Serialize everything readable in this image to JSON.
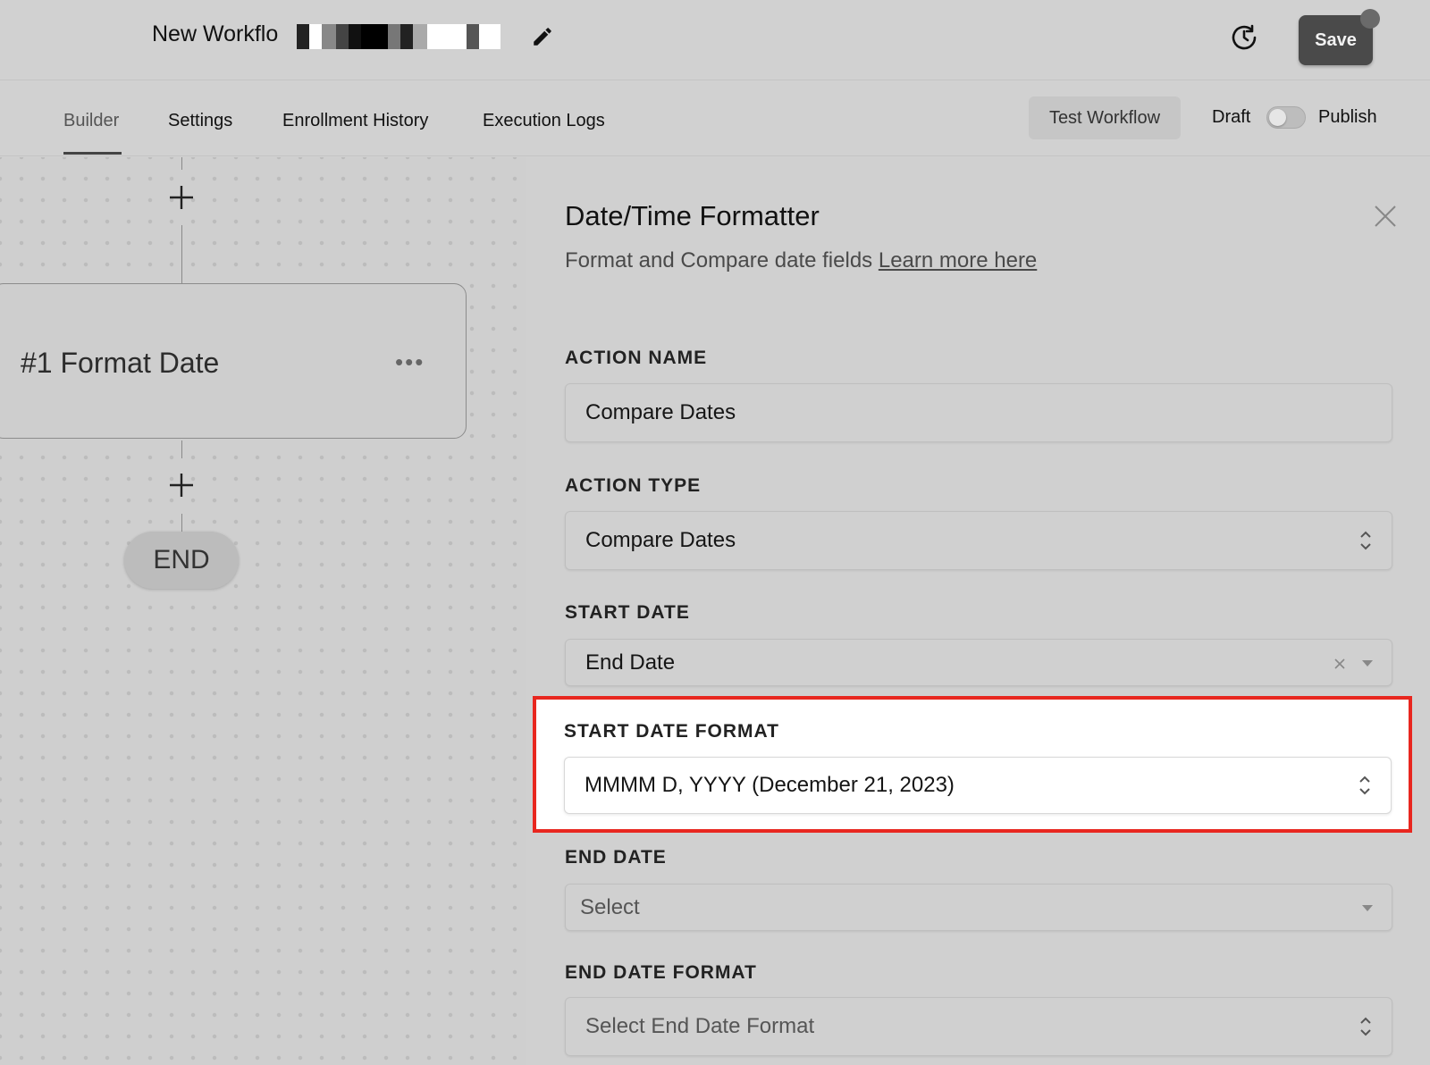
{
  "header": {
    "workflow_title": "New Workflo",
    "save_label": "Save"
  },
  "tabs": [
    {
      "label": "Builder"
    },
    {
      "label": "Settings"
    },
    {
      "label": "Enrollment History"
    },
    {
      "label": "Execution Logs"
    }
  ],
  "toolbar": {
    "test_label": "Test Workflow",
    "draft_label": "Draft",
    "publish_label": "Publish",
    "publish_toggle_on": false
  },
  "canvas": {
    "node_title": "#1 Format Date",
    "node_menu": "•••",
    "end_label": "END"
  },
  "panel": {
    "title": "Date/Time Formatter",
    "subtitle": "Format and Compare date fields",
    "learn_more": "Learn more here",
    "fields": {
      "action_name": {
        "label": "ACTION NAME",
        "value": "Compare Dates"
      },
      "action_type": {
        "label": "ACTION TYPE",
        "value": "Compare Dates"
      },
      "start_date": {
        "label": "START DATE",
        "value": "End Date"
      },
      "start_date_format": {
        "label": "START DATE FORMAT",
        "value": "MMMM D, YYYY (December 21, 2023)"
      },
      "end_date": {
        "label": "END DATE",
        "placeholder": "Select"
      },
      "end_date_format": {
        "label": "END DATE FORMAT",
        "placeholder": "Select End Date Format"
      }
    }
  },
  "colors": {
    "highlight_border": "#e8271f",
    "save_button": "#4a4a4a"
  }
}
